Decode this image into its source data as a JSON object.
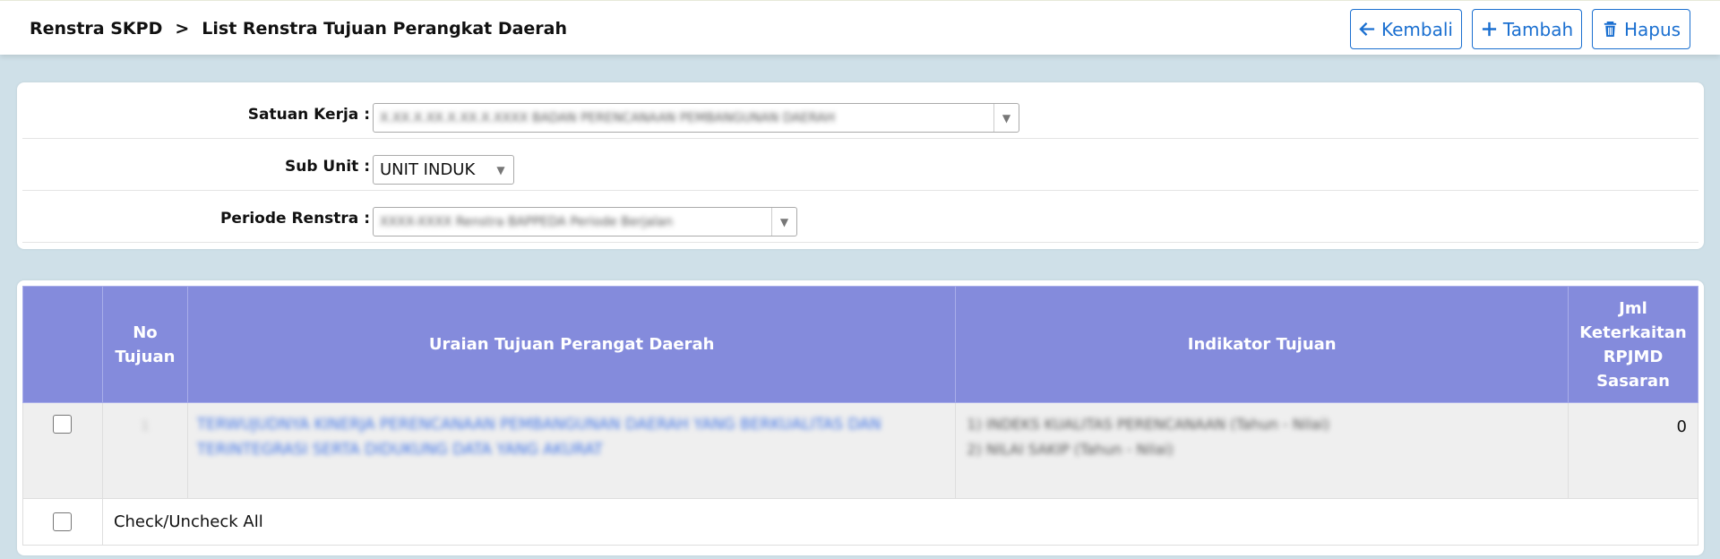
{
  "header": {
    "breadcrumb_root": "Renstra SKPD",
    "breadcrumb_sep": ">",
    "breadcrumb_current": "List Renstra Tujuan Perangkat Daerah",
    "buttons": {
      "back_label": "Kembali",
      "add_label": "Tambah",
      "delete_label": "Hapus"
    },
    "accent_color": "#1a6fd0"
  },
  "filters": {
    "satuan_kerja": {
      "label": "Satuan Kerja :",
      "value": "X.XX.X.XX.X.XX.X.XXXX BADAN PERENCANAAN PEMBANGUNAN DAERAH"
    },
    "sub_unit": {
      "label": "Sub Unit :",
      "value": "UNIT INDUK"
    },
    "periode_renstra": {
      "label": "Periode Renstra :",
      "value": "XXXX-XXXX Renstra BAPPEDA Periode Berjalan"
    }
  },
  "table": {
    "header_color": "#848bdc",
    "columns": {
      "no_tujuan": "No Tujuan",
      "uraian": "Uraian Tujuan Perangat Daerah",
      "indikator": "Indikator Tujuan",
      "jml": "Jml Keterkaitan RPJMD Sasaran"
    },
    "rows": [
      {
        "no": "1",
        "uraian": "TERWUJUDNYA KINERJA PERENCANAAN PEMBANGUNAN DAERAH YANG BERKUALITAS DAN TERINTEGRASI SERTA DIDUKUNG DATA YANG AKURAT",
        "indikator_1": "1) INDEKS KUALITAS PERENCANAAN (Tahun - Nilai)",
        "indikator_2": "2) NILAI SAKIP (Tahun - Nilai)",
        "jml": "0"
      }
    ],
    "check_all_label": "Check/Uncheck All"
  }
}
